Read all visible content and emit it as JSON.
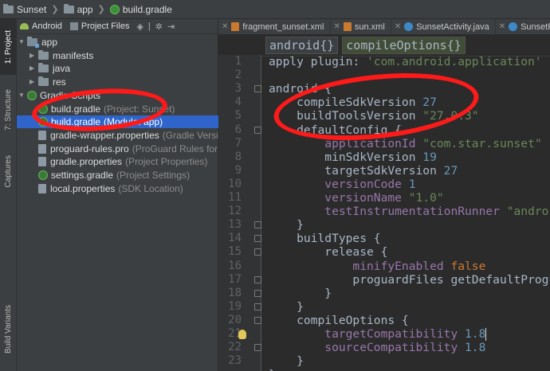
{
  "breadcrumb": [
    {
      "label": "Sunset",
      "icon": "folder-icon"
    },
    {
      "label": "app",
      "icon": "module-folder-icon"
    },
    {
      "label": "build.gradle",
      "icon": "gradle-icon"
    }
  ],
  "left_strip": {
    "tabs": [
      "1: Project",
      "7: Structure",
      "Captures",
      "Build Variants"
    ]
  },
  "project_panel": {
    "view_selector": "Android",
    "files_label": "Project Files",
    "toolbar_icons": [
      "scroll-from-source-icon",
      "gear-icon",
      "hide-icon"
    ]
  },
  "tree": [
    {
      "label": "app",
      "hint": "",
      "icon": "module-folder-icon",
      "expanded": true,
      "level": 0
    },
    {
      "label": "manifests",
      "hint": "",
      "icon": "folder-icon",
      "expanded": false,
      "level": 1
    },
    {
      "label": "java",
      "hint": "",
      "icon": "folder-icon",
      "expanded": false,
      "level": 1
    },
    {
      "label": "res",
      "hint": "",
      "icon": "folder-icon",
      "expanded": false,
      "level": 1
    },
    {
      "label": "Gradle Scripts",
      "hint": "",
      "icon": "gradle-icon",
      "expanded": true,
      "level": 0
    },
    {
      "label": "build.gradle",
      "hint": "(Project: Sunset)",
      "icon": "gradle-icon",
      "level": 1
    },
    {
      "label": "build.gradle",
      "hint": "(Module: app)",
      "icon": "gradle-icon",
      "level": 1,
      "selected": true
    },
    {
      "label": "gradle-wrapper.properties",
      "hint": "(Gradle Version)",
      "icon": "properties-file-icon",
      "level": 1
    },
    {
      "label": "proguard-rules.pro",
      "hint": "(ProGuard Rules for app)",
      "icon": "file-icon",
      "level": 1
    },
    {
      "label": "gradle.properties",
      "hint": "(Project Properties)",
      "icon": "properties-file-icon",
      "level": 1
    },
    {
      "label": "settings.gradle",
      "hint": "(Project Settings)",
      "icon": "gradle-icon",
      "level": 1
    },
    {
      "label": "local.properties",
      "hint": "(SDK Location)",
      "icon": "properties-file-icon",
      "level": 1
    }
  ],
  "editor_tabs": [
    {
      "label": "fragment_sunset.xml",
      "icon": "xml-file-icon"
    },
    {
      "label": "sun.xml",
      "icon": "xml-file-icon"
    },
    {
      "label": "SunsetActivity.java",
      "icon": "java-class-icon"
    },
    {
      "label": "SunsetFragment.java",
      "icon": "java-class-icon"
    }
  ],
  "editor_breadcrumb": [
    "android{}",
    "compileOptions{}"
  ],
  "line_numbers": [
    "1",
    "2",
    "3",
    "4",
    "5",
    "6",
    "7",
    "8",
    "9",
    "10",
    "11",
    "12",
    "13",
    "14",
    "15",
    "16",
    "17",
    "18",
    "19",
    "20",
    "21",
    "22",
    "23"
  ],
  "code_lines": [
    [
      {
        "t": "apply ",
        "c": "p"
      },
      {
        "t": "plugin",
        "c": "p"
      },
      {
        "t": ": ",
        "c": "p"
      },
      {
        "t": "'com.android.application'",
        "c": "s"
      }
    ],
    [],
    [
      {
        "t": "android {",
        "c": "p"
      }
    ],
    [
      {
        "t": "    compileSdkVersion ",
        "c": "p"
      },
      {
        "t": "27",
        "c": "n"
      }
    ],
    [
      {
        "t": "    buildToolsVersion ",
        "c": "p"
      },
      {
        "t": "\"27.0.3\"",
        "c": "s"
      }
    ],
    [
      {
        "t": "    defaultConfig {",
        "c": "p"
      }
    ],
    [
      {
        "t": "        applicationId ",
        "c": "k"
      },
      {
        "t": "\"com.star.sunset\"",
        "c": "s"
      }
    ],
    [
      {
        "t": "        minSdkVersion ",
        "c": "p"
      },
      {
        "t": "19",
        "c": "n"
      }
    ],
    [
      {
        "t": "        targetSdkVersion ",
        "c": "p"
      },
      {
        "t": "27",
        "c": "n"
      }
    ],
    [
      {
        "t": "        versionCode ",
        "c": "k"
      },
      {
        "t": "1",
        "c": "n"
      }
    ],
    [
      {
        "t": "        versionName ",
        "c": "k"
      },
      {
        "t": "\"1.0\"",
        "c": "s"
      }
    ],
    [
      {
        "t": "        testInstrumentationRunner ",
        "c": "k"
      },
      {
        "t": "\"android.support.test.runner.AndroidJUnitRunner\"",
        "c": "s"
      }
    ],
    [
      {
        "t": "    }",
        "c": "p"
      }
    ],
    [
      {
        "t": "    buildTypes {",
        "c": "p"
      }
    ],
    [
      {
        "t": "        release {",
        "c": "p"
      }
    ],
    [
      {
        "t": "            minifyEnabled ",
        "c": "k"
      },
      {
        "t": "false",
        "c": "w"
      }
    ],
    [
      {
        "t": "            proguardFiles getDefaultProguardFile(",
        "c": "p"
      }
    ],
    [
      {
        "t": "        }",
        "c": "p"
      }
    ],
    [
      {
        "t": "    }",
        "c": "p"
      }
    ],
    [
      {
        "t": "    compileOptions {",
        "c": "p"
      }
    ],
    [
      {
        "t": "        targetCompatibility ",
        "c": "k"
      },
      {
        "t": "1.8",
        "c": "n"
      },
      {
        "t": "",
        "c": "caret"
      }
    ],
    [
      {
        "t": "        sourceCompatibility ",
        "c": "k"
      },
      {
        "t": "1.8",
        "c": "n"
      }
    ],
    [
      {
        "t": "    }",
        "c": "p"
      }
    ],
    [
      {
        "t": "}",
        "c": "p"
      }
    ]
  ],
  "colors": {
    "selection": "#2f65ca",
    "annotation": "#ff1a1a",
    "string": "#6a8759",
    "number": "#6897bb",
    "property": "#9876aa",
    "keyword": "#cc7832"
  }
}
